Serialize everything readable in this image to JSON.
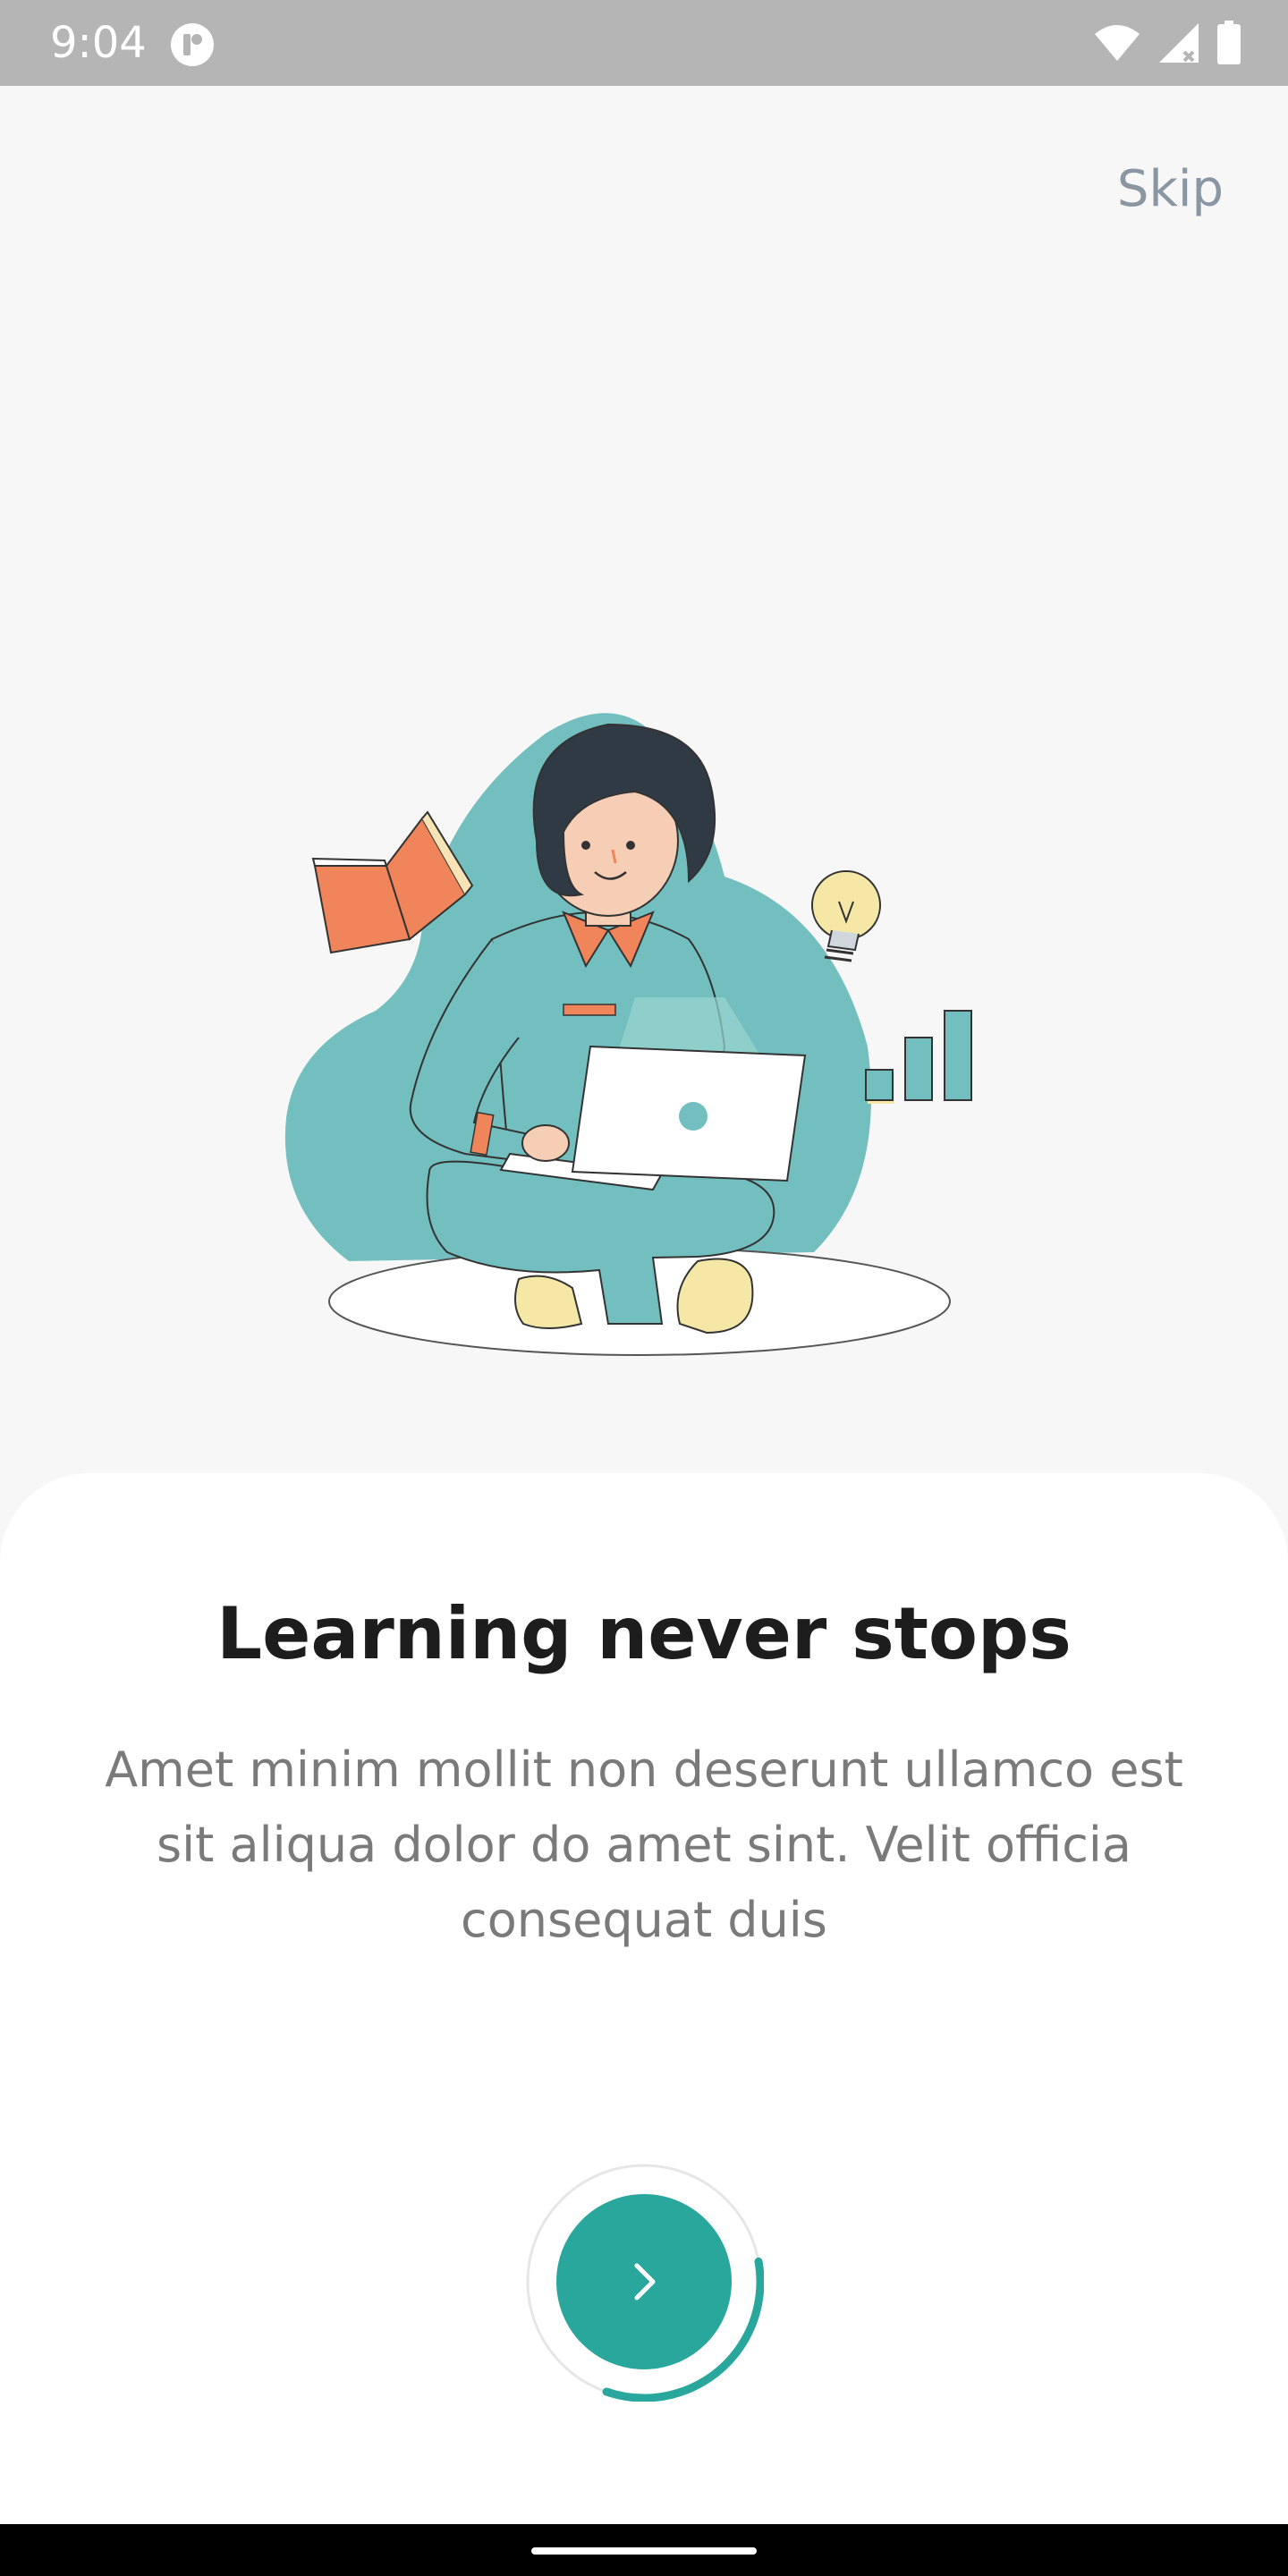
{
  "status_bar": {
    "time": "9:04",
    "icons": [
      "app-notification-icon",
      "wifi-icon",
      "signal-icon",
      "battery-icon"
    ]
  },
  "header": {
    "skip_label": "Skip"
  },
  "onboarding": {
    "title": "Learning never stops",
    "description": "Amet minim mollit non deserunt ullamco est sit aliqua dolor do amet sint. Velit officia consequat duis",
    "progress": 0.33
  },
  "colors": {
    "accent": "#2aa79d",
    "blob": "#73bfbf",
    "orange": "#f0845a",
    "text_primary": "#1d1d1d",
    "text_secondary": "#7a7a7a",
    "skip": "#8a97a3"
  }
}
